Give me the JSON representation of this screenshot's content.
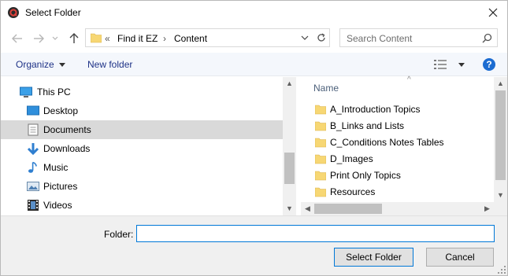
{
  "window": {
    "title": "Select Folder",
    "app_icon": "quickhelp-q-icon",
    "close_icon": "close-icon"
  },
  "nav": {
    "back_icon": "back-arrow-icon",
    "forward_icon": "forward-arrow-icon",
    "recent_icon": "chevron-down-icon",
    "up_icon": "up-arrow-icon",
    "breadcrumb_overflow": "«",
    "breadcrumb": [
      "Find it EZ",
      "Content"
    ],
    "separator": "›",
    "refresh_icon": "refresh-icon",
    "search_placeholder": "Search Content",
    "search_icon": "search-icon"
  },
  "toolbar": {
    "organize_label": "Organize",
    "new_folder_label": "New folder",
    "view_icon": "details-view-icon",
    "help_icon": "help-icon",
    "help_glyph": "?"
  },
  "tree": {
    "items": [
      {
        "label": "This PC",
        "icon": "computer-icon"
      },
      {
        "label": "Desktop",
        "icon": "desktop-icon"
      },
      {
        "label": "Documents",
        "icon": "documents-icon",
        "selected": true
      },
      {
        "label": "Downloads",
        "icon": "downloads-icon"
      },
      {
        "label": "Music",
        "icon": "music-icon"
      },
      {
        "label": "Pictures",
        "icon": "pictures-icon"
      },
      {
        "label": "Videos",
        "icon": "videos-icon"
      }
    ]
  },
  "files": {
    "column_header": "Name",
    "items": [
      "A_Introduction Topics",
      "B_Links and Lists",
      "C_Conditions Notes Tables",
      "D_Images",
      "Print Only Topics",
      "Resources"
    ]
  },
  "bottom": {
    "folder_label": "Folder:",
    "folder_value": "",
    "select_label": "Select Folder",
    "cancel_label": "Cancel"
  },
  "colors": {
    "accent": "#0078d7",
    "folder": "#f7d774",
    "selection": "#d9d9d9",
    "toolbar_bg": "#f4f7fc",
    "link_text": "#1e3287"
  }
}
